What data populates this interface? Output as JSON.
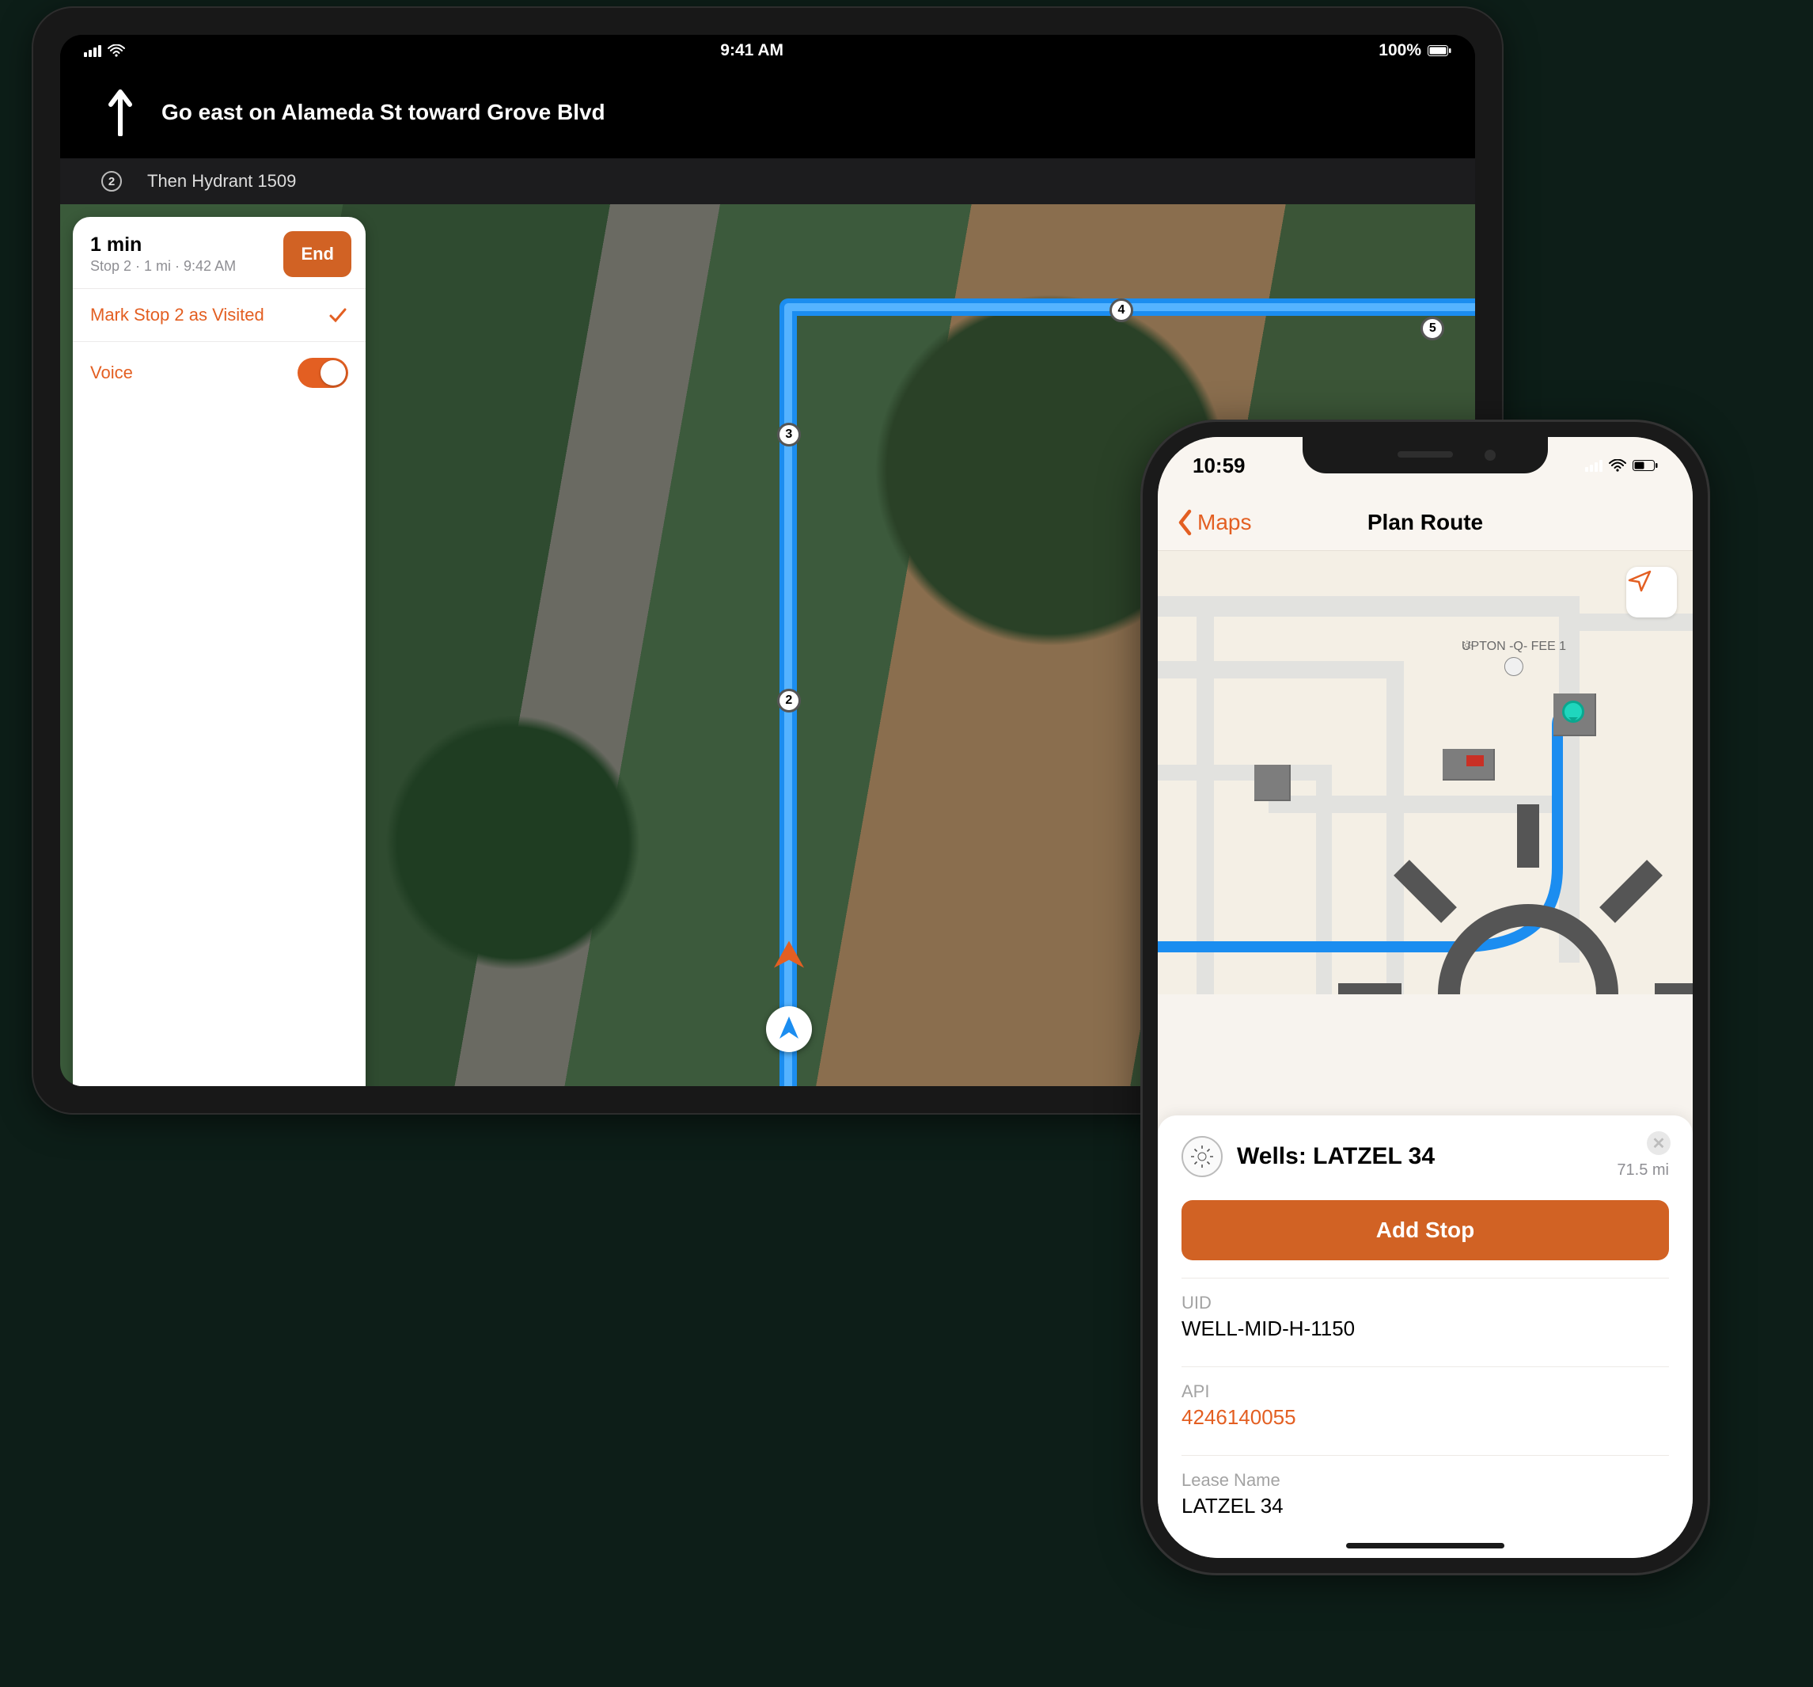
{
  "colors": {
    "accent": "#d16224",
    "accent_bright": "#e35f22"
  },
  "ipad": {
    "status": {
      "time": "9:41 AM",
      "battery_pct": "100%"
    },
    "direction": {
      "primary": "Go east on Alameda St toward Grove Blvd"
    },
    "sub_direction": {
      "step_number": "2",
      "text": "Then Hydrant 1509"
    },
    "panel": {
      "eta_title": "1 min",
      "eta_sub": "Stop 2 · 1 mi · 9:42 AM",
      "end_label": "End",
      "mark_label": "Mark Stop 2 as Visited",
      "voice_label": "Voice",
      "voice_on": true
    },
    "waypoints": [
      "2",
      "3",
      "4",
      "5"
    ]
  },
  "iphone": {
    "status": {
      "time": "10:59"
    },
    "nav": {
      "back_label": "Maps",
      "title": "Plan Route"
    },
    "poi_label": "UPTON -Q- FEE 1",
    "card": {
      "title": "Wells: LATZEL 34",
      "distance": "71.5 mi",
      "add_stop_label": "Add Stop",
      "fields": [
        {
          "label": "UID",
          "value": "WELL-MID-H-1150",
          "accent": false
        },
        {
          "label": "API",
          "value": "4246140055",
          "accent": true
        },
        {
          "label": "Lease Name",
          "value": "LATZEL 34",
          "accent": false
        }
      ]
    }
  }
}
